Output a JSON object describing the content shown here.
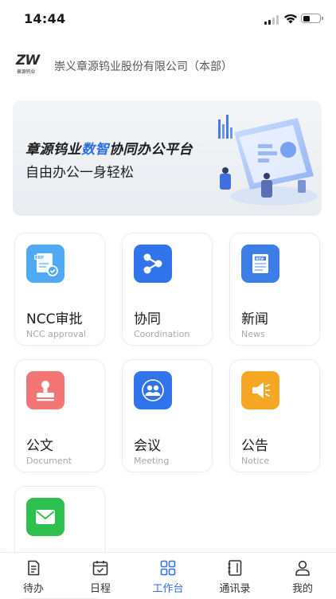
{
  "status_bar": {
    "time": "14:44",
    "battery_level": 0.35
  },
  "company": {
    "name": "崇义章源钨业股份有限公司（本部）",
    "logo_text": "ZW",
    "logo_subtext": "章源钨业"
  },
  "banner": {
    "title_part1": "章源钨业",
    "title_part2": "数智",
    "title_part3": "协同办公平台",
    "subtitle": "自由办公一身轻松"
  },
  "apps": [
    {
      "label": "NCC审批",
      "sublabel": "NCC approval",
      "icon": "erp-approval-icon",
      "color": "#4fa9f5"
    },
    {
      "label": "协同",
      "sublabel": "Coordination",
      "icon": "share-nodes-icon",
      "color": "#2f74ea"
    },
    {
      "label": "新闻",
      "sublabel": "News",
      "icon": "news-icon",
      "color": "#3b7ee8"
    },
    {
      "label": "公文",
      "sublabel": "Document",
      "icon": "stamp-icon",
      "color": "#f27676"
    },
    {
      "label": "会议",
      "sublabel": "Meeting",
      "icon": "users-icon",
      "color": "#2f74ea"
    },
    {
      "label": "公告",
      "sublabel": "Notice",
      "icon": "megaphone-icon",
      "color": "#f5a623"
    },
    {
      "label": "",
      "sublabel": "",
      "icon": "mail-icon",
      "color": "#2ec04f"
    }
  ],
  "tabbar": {
    "items": [
      {
        "label": "待办",
        "icon": "todo-list-icon"
      },
      {
        "label": "日程",
        "icon": "calendar-icon"
      },
      {
        "label": "工作台",
        "icon": "workbench-grid-icon"
      },
      {
        "label": "通讯录",
        "icon": "address-book-icon"
      },
      {
        "label": "我的",
        "icon": "user-icon"
      }
    ],
    "active_index": 2,
    "active_color": "#2f6fe2"
  }
}
